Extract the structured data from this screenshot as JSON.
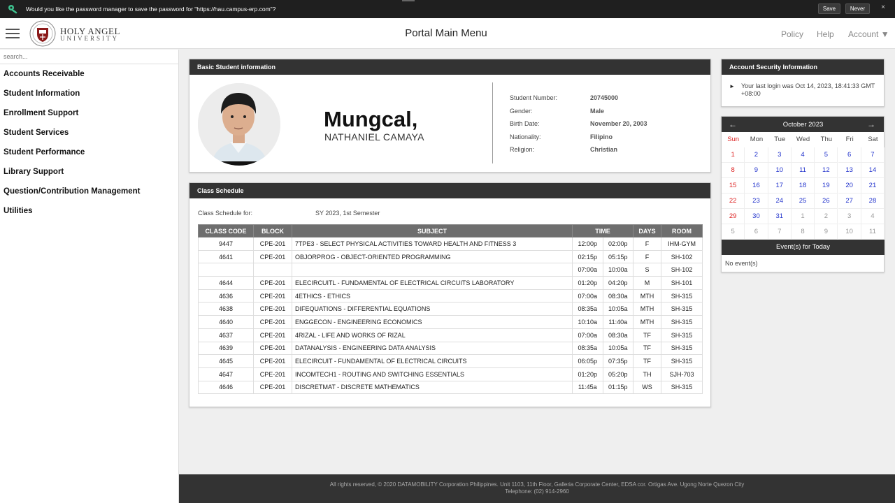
{
  "password_bar": {
    "message": "Would you like the password manager to save the password for \"https://hau.campus-erp.com\"?",
    "save_label": "Save",
    "never_label": "Never",
    "close_label": "×"
  },
  "header": {
    "logo_line1": "HOLY ANGEL",
    "logo_line2": "UNIVERSITY",
    "title": "Portal Main Menu",
    "links": {
      "policy": "Policy",
      "help": "Help",
      "account": "Account ▼"
    }
  },
  "sidebar": {
    "search_placeholder": "search...",
    "items": [
      "Accounts Receivable",
      "Student Information",
      "Enrollment Support",
      "Student Services",
      "Student Performance",
      "Library Support",
      "Question/Contribution Management",
      "Utilities"
    ]
  },
  "student_panel": {
    "title": "Basic Student information",
    "last_name": "Mungcal,",
    "first_name": "NATHANIEL CAMAYA",
    "fields": [
      {
        "label": "Student Number:",
        "value": "20745000"
      },
      {
        "label": "Gender:",
        "value": "Male"
      },
      {
        "label": "Birth Date:",
        "value": "November 20, 2003"
      },
      {
        "label": "Nationality:",
        "value": "Filipino"
      },
      {
        "label": "Religion:",
        "value": "Christian"
      }
    ]
  },
  "schedule_panel": {
    "title": "Class Schedule",
    "for_label": "Class Schedule for:",
    "term": "SY 2023, 1st Semester",
    "columns": [
      "CLASS CODE",
      "BLOCK",
      "SUBJECT",
      "TIME",
      "DAYS",
      "ROOM"
    ],
    "rows": [
      {
        "code": "9447",
        "block": "CPE-201",
        "subject": "7TPE3 - SELECT PHYSICAL ACTIVITIES TOWARD HEALTH AND FITNESS 3",
        "start": "12:00p",
        "end": "02:00p",
        "days": "F",
        "room": "IHM-GYM"
      },
      {
        "code": "4641",
        "block": "CPE-201",
        "subject": "OBJORPROG - OBJECT-ORIENTED PROGRAMMING",
        "start": "02:15p",
        "end": "05:15p",
        "days": "F",
        "room": "SH-102"
      },
      {
        "code": "",
        "block": "",
        "subject": "",
        "start": "07:00a",
        "end": "10:00a",
        "days": "S",
        "room": "SH-102"
      },
      {
        "code": "4644",
        "block": "CPE-201",
        "subject": "ELECIRCUITL - FUNDAMENTAL OF ELECTRICAL CIRCUITS LABORATORY",
        "start": "01:20p",
        "end": "04:20p",
        "days": "M",
        "room": "SH-101"
      },
      {
        "code": "4636",
        "block": "CPE-201",
        "subject": "4ETHICS - ETHICS",
        "start": "07:00a",
        "end": "08:30a",
        "days": "MTH",
        "room": "SH-315"
      },
      {
        "code": "4638",
        "block": "CPE-201",
        "subject": "DIFEQUATIONS - DIFFERENTIAL EQUATIONS",
        "start": "08:35a",
        "end": "10:05a",
        "days": "MTH",
        "room": "SH-315"
      },
      {
        "code": "4640",
        "block": "CPE-201",
        "subject": "ENGGECON - ENGINEERING ECONOMICS",
        "start": "10:10a",
        "end": "11:40a",
        "days": "MTH",
        "room": "SH-315"
      },
      {
        "code": "4637",
        "block": "CPE-201",
        "subject": "4RIZAL - LIFE AND WORKS OF RIZAL",
        "start": "07:00a",
        "end": "08:30a",
        "days": "TF",
        "room": "SH-315"
      },
      {
        "code": "4639",
        "block": "CPE-201",
        "subject": "DATANALYSIS - ENGINEERING DATA ANALYSIS",
        "start": "08:35a",
        "end": "10:05a",
        "days": "TF",
        "room": "SH-315"
      },
      {
        "code": "4645",
        "block": "CPE-201",
        "subject": "ELECIRCUIT - FUNDAMENTAL OF ELECTRICAL CIRCUITS",
        "start": "06:05p",
        "end": "07:35p",
        "days": "TF",
        "room": "SH-315"
      },
      {
        "code": "4647",
        "block": "CPE-201",
        "subject": "INCOMTECH1 - ROUTING AND SWITCHING ESSENTIALS",
        "start": "01:20p",
        "end": "05:20p",
        "days": "TH",
        "room": "SJH-703"
      },
      {
        "code": "4646",
        "block": "CPE-201",
        "subject": "DISCRETMAT - DISCRETE MATHEMATICS",
        "start": "11:45a",
        "end": "01:15p",
        "days": "WS",
        "room": "SH-315"
      }
    ]
  },
  "security_panel": {
    "title": "Account Security Information",
    "last_login": "Your last login was Oct 14, 2023, 18:41:33 GMT +08:00"
  },
  "calendar": {
    "prev": "←",
    "next": "→",
    "month": "October 2023",
    "weekdays": [
      "Sun",
      "Mon",
      "Tue",
      "Wed",
      "Thu",
      "Fri",
      "Sat"
    ],
    "days": [
      "1",
      "2",
      "3",
      "4",
      "5",
      "6",
      "7",
      "8",
      "9",
      "10",
      "11",
      "12",
      "13",
      "14",
      "15",
      "16",
      "17",
      "18",
      "19",
      "20",
      "21",
      "22",
      "23",
      "24",
      "25",
      "26",
      "27",
      "28",
      "29",
      "30",
      "31",
      "1",
      "2",
      "3",
      "4",
      "5",
      "6",
      "7",
      "8",
      "9",
      "10",
      "11"
    ],
    "current_month_count": 31,
    "events_title": "Event(s) for Today",
    "events_text": "No event(s)"
  },
  "footer": {
    "line1": "All rights reserved, © 2020 DATAMOBILITY Corporation Philippines. Unit 1103, 11th Floor, Galleria Corporate Center, EDSA cor. Ortigas Ave. Ugong Norte Quezon City",
    "line2": "Telephone: (02) 914-2960"
  },
  "colors": {
    "header_dark": "#333333",
    "table_header": "#6e6e6e",
    "calendar_day": "#2233cc",
    "calendar_sunday": "#dd2222",
    "key_icon": "#3ec28f"
  }
}
